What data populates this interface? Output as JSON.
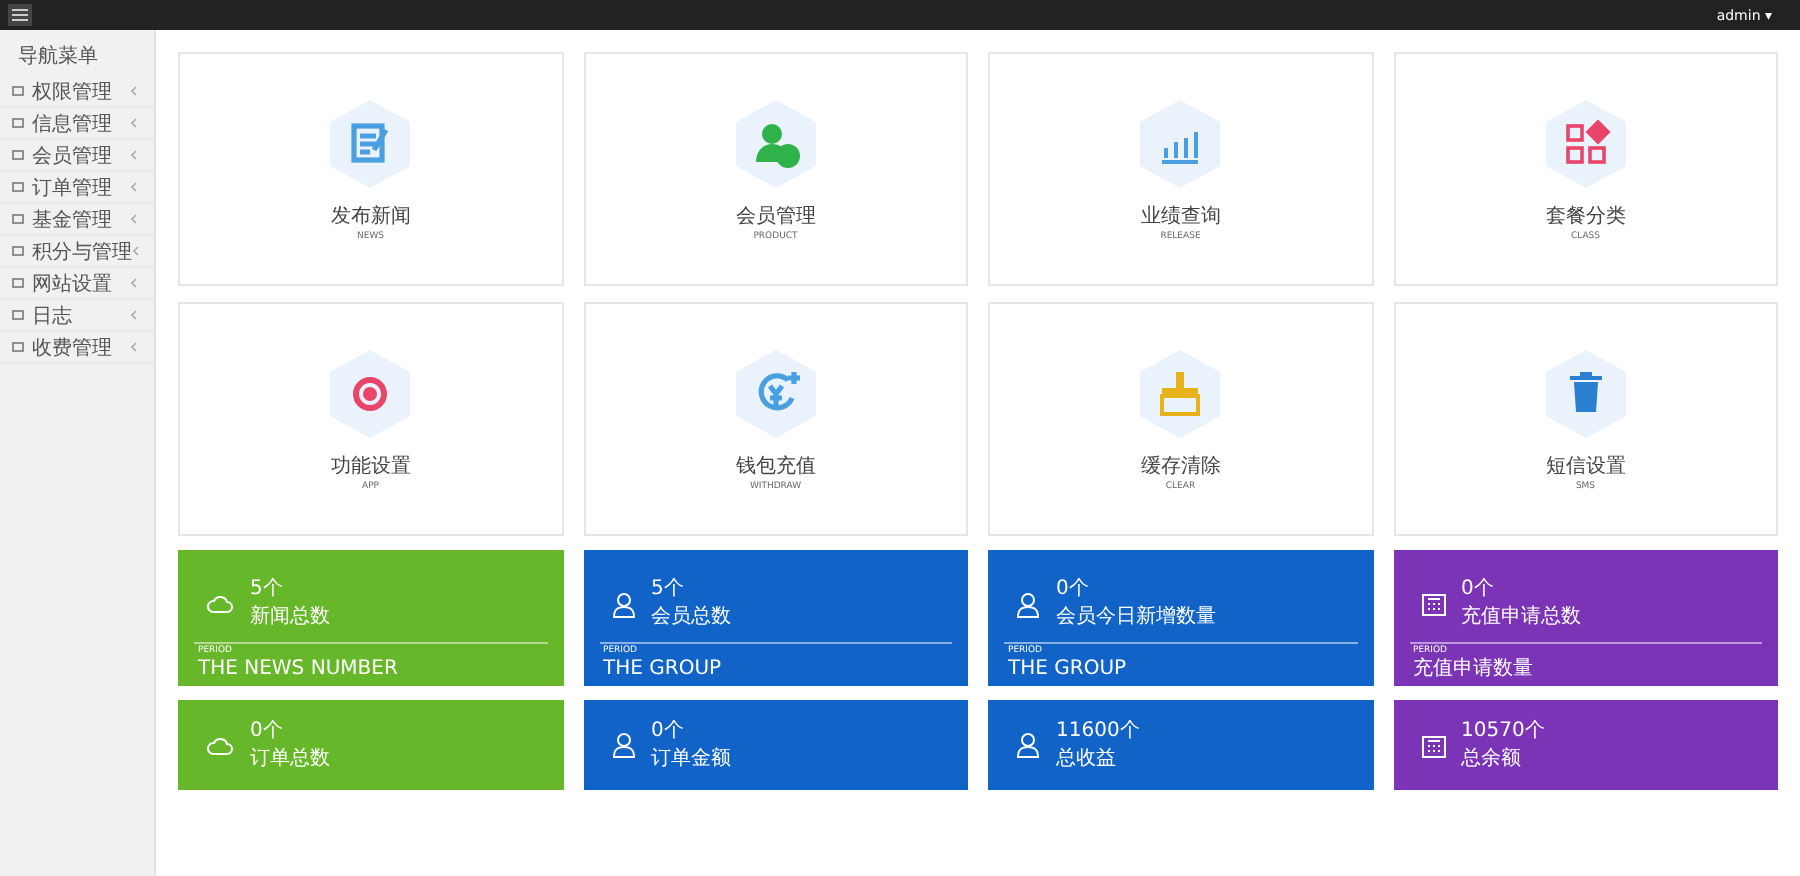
{
  "topbar": {
    "user": "admin",
    "caret": "▾"
  },
  "sidebar": {
    "title": "导航菜单",
    "items": [
      {
        "label": "权限管理",
        "expanded": false
      },
      {
        "label": "信息管理",
        "expanded": false
      },
      {
        "label": "会员管理",
        "expanded": false
      },
      {
        "label": "订单管理",
        "expanded": false
      },
      {
        "label": "基金管理",
        "expanded": false
      },
      {
        "label": "积分与管理",
        "expanded": false
      },
      {
        "label": "网站设置",
        "expanded": false
      },
      {
        "label": "日志",
        "expanded": false
      },
      {
        "label": "收费管理",
        "expanded": false
      }
    ]
  },
  "tiles": [
    {
      "kind": "news",
      "title": "发布新闻",
      "subtitle": "NEWS",
      "color": "#4a9fe0"
    },
    {
      "kind": "member",
      "title": "会员管理",
      "subtitle": "PRODUCT",
      "color": "#2fb24a"
    },
    {
      "kind": "chart",
      "title": "业绩查询",
      "subtitle": "RELEASE",
      "color": "#4a9fe0"
    },
    {
      "kind": "apps",
      "title": "套餐分类",
      "subtitle": "CLASS",
      "color": "#e8456b"
    },
    {
      "kind": "gear",
      "title": "功能设置",
      "subtitle": "APP",
      "color": "#e8456b"
    },
    {
      "kind": "wallet",
      "title": "钱包充值",
      "subtitle": "WITHDRAW",
      "color": "#4a9fe0"
    },
    {
      "kind": "broom",
      "title": "缓存清除",
      "subtitle": "CLEAR",
      "color": "#e8b21c"
    },
    {
      "kind": "trash",
      "title": "短信设置",
      "subtitle": "SMS",
      "color": "#2a7fd0"
    }
  ],
  "stats": [
    {
      "kind": "cloud",
      "value": "5个",
      "label": "新闻总数",
      "caption": "PERIOD",
      "footer": "THE NEWS NUMBER",
      "color": "#67b72a"
    },
    {
      "kind": "user",
      "value": "5个",
      "label": "会员总数",
      "caption": "PERIOD",
      "footer": "THE GROUP",
      "color": "#1263c7"
    },
    {
      "kind": "user",
      "value": "0个",
      "label": "会员今日新增数量",
      "caption": "PERIOD",
      "footer": "THE GROUP",
      "color": "#1263c7"
    },
    {
      "kind": "calendar",
      "value": "0个",
      "label": "充值申请总数",
      "caption": "PERIOD",
      "footer": "充值申请数量",
      "color": "#7b34b5"
    }
  ],
  "stats2": [
    {
      "kind": "cloud",
      "value": "0个",
      "label": "订单总数",
      "color": "#67b72a"
    },
    {
      "kind": "user",
      "value": "0个",
      "label": "订单金额",
      "color": "#1263c7"
    },
    {
      "kind": "user",
      "value": "11600个",
      "label": "总收益",
      "color": "#1263c7"
    },
    {
      "kind": "calendar",
      "value": "10570个",
      "label": "总余额",
      "color": "#7b34b5"
    }
  ]
}
